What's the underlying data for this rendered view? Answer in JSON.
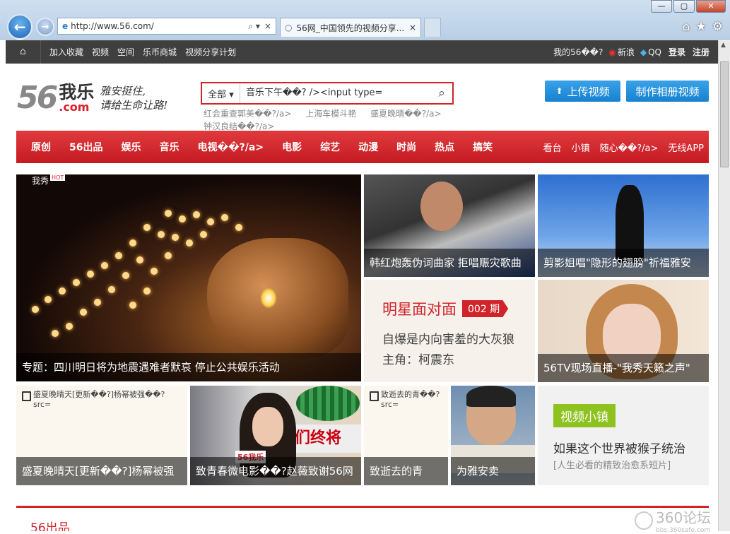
{
  "browser": {
    "url": "http://www.56.com/",
    "tab_title": "56网_中国领先的视频分享...",
    "tab_close": "×",
    "addr_search": "⌕ ▾",
    "addr_close": "×",
    "back": "←",
    "fwd": "→",
    "win": {
      "min": "—",
      "max": "▢",
      "close": "✕"
    },
    "tools": {
      "home": "⌂",
      "star": "★",
      "gear": "⚙"
    }
  },
  "topbar": {
    "links": [
      "加入收藏",
      "视频",
      "空间",
      "乐币商城",
      "视频分享计划"
    ],
    "my56": "我的56��?",
    "weibo": "新浪",
    "qq": "QQ",
    "login": "登录",
    "register": "注册"
  },
  "logo": {
    "num": "56",
    "cn": "我乐",
    "com": ".com",
    "slogan_1": "雅安挺住,",
    "slogan_2": "请给生命让路!"
  },
  "search": {
    "category": "全部 ▾",
    "query": "音乐下午��? /><input type=",
    "hot": [
      "红会重查郭美��?/a>",
      "上海车模斗艳",
      "盛夏晚晴��?/a>",
      "钟汉良结��?/a>"
    ]
  },
  "buttons": {
    "upload": "上传视频",
    "album": "制作相册视频"
  },
  "channels": {
    "main": [
      "原创",
      "56出品",
      "娱乐",
      "音乐",
      "电视��?/a>",
      "电影",
      "综艺",
      "动漫",
      "时尚",
      "热点",
      "搞笑"
    ],
    "right": [
      "看台",
      "小镇",
      "随心��?/a>",
      "无线APP"
    ]
  },
  "tiles": {
    "main_hot": "我秀",
    "hot_badge": "HOT",
    "main": "专题：四川明日将为地震遇难者默哀 停止公共娱乐活动",
    "han": "韩红炮轰伪词曲家 拒唱赈灾歌曲",
    "shadow": "剪影姐唱\"隐形的翅膀\"祈福雅安",
    "face_title": "明星面对面",
    "face_issue": "002 期",
    "face_sub": "自爆是内向害羞的大灰狼",
    "face_role": "主角：柯震东",
    "girl": "56TV现场直播-\"我秀天籁之声\""
  },
  "small": {
    "s1_broken": "盛夏晚晴天[更新��?]杨幂被强��? src=",
    "s1_cap": "盛夏晚晴天[更新��?]杨幂被强",
    "s2_banner": "我们终将",
    "s2_logo": "56我乐",
    "s2_cap": "致青春微电影��?赵薇致谢56网",
    "s3_broken": "致逝去的青��? src=",
    "s3_cap": "致逝去的青",
    "s4_cap": "为雅安卖",
    "s5_tag": "视频小镇",
    "s5_title": "如果这个世界被猴子统治",
    "s5_sub": "[人生必看的精致治愈系短片]"
  },
  "section": {
    "title": "56出品"
  },
  "watermark": {
    "big": "360论坛",
    "small": "bbs.360safe.com"
  }
}
